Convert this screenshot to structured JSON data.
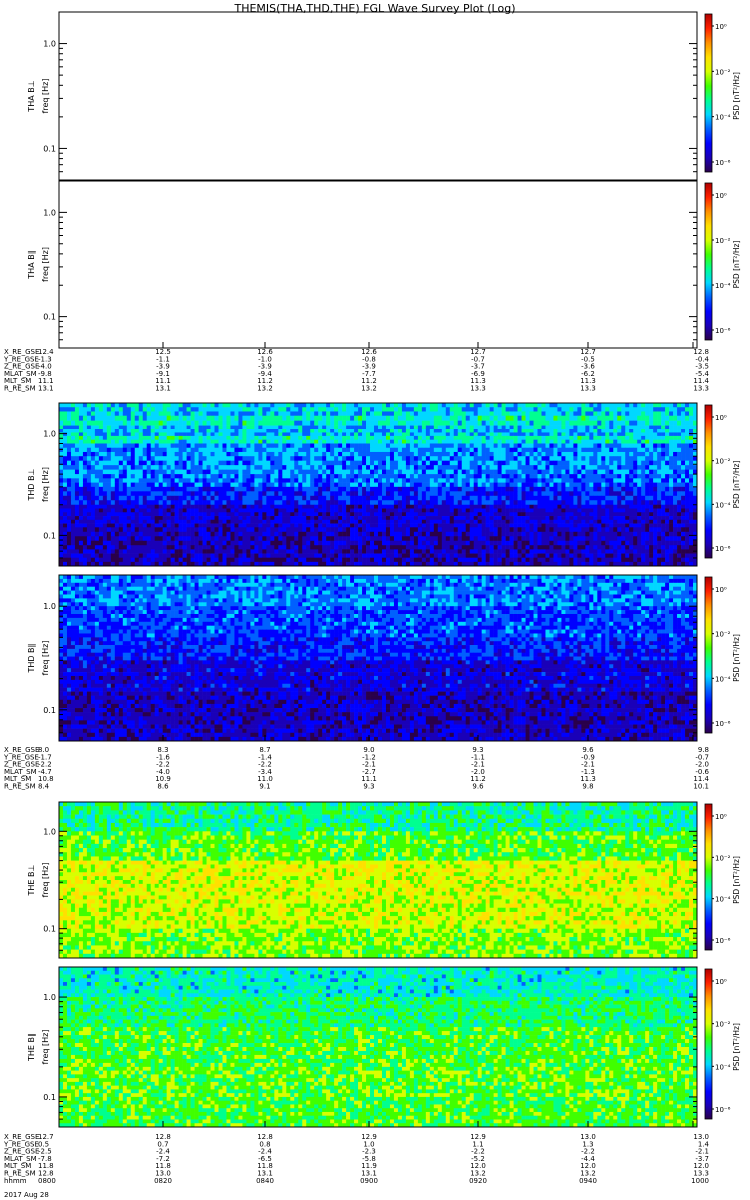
{
  "title": "THEMIS(THA,THD,THE) FGL Wave Survey Plot (Log)",
  "colors": {
    "missing": "#ffffff",
    "frame": "#000000"
  },
  "colormap": [
    "#2a004a",
    "#1a00b8",
    "#0000ff",
    "#0060ff",
    "#00d8ff",
    "#00ff90",
    "#40ff00",
    "#d8ff00",
    "#ffe000",
    "#ff9000",
    "#ff2000",
    "#b00000"
  ],
  "colorbar": {
    "label": "PSD [nT²/Hz]",
    "ticks": [
      "10⁰",
      "10⁻²",
      "10⁻⁴",
      "10⁻⁶"
    ]
  },
  "chart_data": [
    {
      "type": "heatmap",
      "panel": "THA B⊥",
      "ylabel_probe": "THA B⊥",
      "ylabel": "freq [Hz]",
      "yscale": "log",
      "ylim": [
        0.05,
        2.0
      ],
      "yticks": [
        "1.0",
        "0.1"
      ],
      "ytick_values": [
        1.0,
        0.1
      ],
      "data": "no data (blank)",
      "has_data": false
    },
    {
      "type": "heatmap",
      "panel": "THA B∥",
      "ylabel_probe": "THA B∥",
      "ylabel": "freq [Hz]",
      "yscale": "log",
      "ylim": [
        0.05,
        2.0
      ],
      "yticks": [
        "1.0",
        "0.1"
      ],
      "ytick_values": [
        1.0,
        0.1
      ],
      "data": "no data (blank)",
      "has_data": false
    },
    {
      "type": "heatmap",
      "panel": "THD B⊥",
      "ylabel_probe": "THD B⊥",
      "ylabel": "freq [Hz]",
      "yscale": "log",
      "ylim": [
        0.05,
        2.0
      ],
      "yticks": [
        "1.0",
        "0.1"
      ],
      "ytick_values": [
        1.0,
        0.1
      ],
      "has_data": true,
      "bands": [
        {
          "f": [
            1.5,
            2.0
          ],
          "level": 4.0
        },
        {
          "f": [
            1.2,
            1.5
          ],
          "level": 4.5
        },
        {
          "f": [
            0.95,
            1.2
          ],
          "level": 3.8
        },
        {
          "f": [
            0.8,
            0.95
          ],
          "level": 4.5
        },
        {
          "f": [
            0.6,
            0.8
          ],
          "level": 3.4
        },
        {
          "f": [
            0.4,
            0.6
          ],
          "level": 3.2
        },
        {
          "f": [
            0.3,
            0.4
          ],
          "level": 3.0
        },
        {
          "f": [
            0.2,
            0.3
          ],
          "level": 2.2
        },
        {
          "f": [
            0.12,
            0.2
          ],
          "level": 1.4
        },
        {
          "f": [
            0.08,
            0.12
          ],
          "level": 1.1
        },
        {
          "f": [
            0.05,
            0.08
          ],
          "level": 1.0
        }
      ]
    },
    {
      "type": "heatmap",
      "panel": "THD B∥",
      "ylabel_probe": "THD B∥",
      "ylabel": "freq [Hz]",
      "yscale": "log",
      "ylim": [
        0.05,
        2.0
      ],
      "yticks": [
        "1.0",
        "0.1"
      ],
      "ytick_values": [
        1.0,
        0.1
      ],
      "has_data": true,
      "bands": [
        {
          "f": [
            1.0,
            2.0
          ],
          "level": 3.2
        },
        {
          "f": [
            0.5,
            1.0
          ],
          "level": 2.6
        },
        {
          "f": [
            0.3,
            0.5
          ],
          "level": 2.2
        },
        {
          "f": [
            0.15,
            0.3
          ],
          "level": 1.5
        },
        {
          "f": [
            0.05,
            0.15
          ],
          "level": 1.1
        }
      ]
    },
    {
      "type": "heatmap",
      "panel": "THE B⊥",
      "ylabel_probe": "THE B⊥",
      "ylabel": "freq [Hz]",
      "yscale": "log",
      "ylim": [
        0.05,
        2.0
      ],
      "yticks": [
        "1.0",
        "0.1"
      ],
      "ytick_values": [
        1.0,
        0.1
      ],
      "has_data": true,
      "bands": [
        {
          "f": [
            1.0,
            2.0
          ],
          "level": 5.0
        },
        {
          "f": [
            0.5,
            1.0
          ],
          "level": 6.0
        },
        {
          "f": [
            0.2,
            0.5
          ],
          "level": 7.2
        },
        {
          "f": [
            0.1,
            0.2
          ],
          "level": 7.0
        },
        {
          "f": [
            0.05,
            0.1
          ],
          "level": 6.3
        }
      ]
    },
    {
      "type": "heatmap",
      "panel": "THE B∥",
      "ylabel_probe": "THE B∥",
      "ylabel": "freq [Hz]",
      "yscale": "log",
      "ylim": [
        0.05,
        2.0
      ],
      "yticks": [
        "1.0",
        "0.1"
      ],
      "ytick_values": [
        1.0,
        0.1
      ],
      "has_data": true,
      "bands": [
        {
          "f": [
            1.0,
            2.0
          ],
          "level": 4.5
        },
        {
          "f": [
            0.5,
            1.0
          ],
          "level": 5.3
        },
        {
          "f": [
            0.2,
            0.5
          ],
          "level": 5.8
        },
        {
          "f": [
            0.1,
            0.2
          ],
          "level": 6.0
        },
        {
          "f": [
            0.05,
            0.1
          ],
          "level": 5.8
        }
      ]
    }
  ],
  "ephemeris": [
    {
      "probe": "THA",
      "rows": [
        {
          "label": "X_RE_GSE",
          "values": [
            "12.4",
            "12.5",
            "12.6",
            "12.6",
            "12.7",
            "12.7",
            "12.8"
          ]
        },
        {
          "label": "Y_RE_GSE",
          "values": [
            "-1.3",
            "-1.1",
            "-1.0",
            "-0.8",
            "-0.7",
            "-0.5",
            "-0.4"
          ]
        },
        {
          "label": "Z_RE_GSE",
          "values": [
            "-4.0",
            "-3.9",
            "-3.9",
            "-3.9",
            "-3.7",
            "-3.6",
            "-3.5"
          ]
        },
        {
          "label": "MLAT_SM",
          "values": [
            "-9.8",
            "-9.1",
            "-9.4",
            "-7.7",
            "-6.9",
            "-6.2",
            "-5.4"
          ]
        },
        {
          "label": "MLT_SM",
          "values": [
            "11.1",
            "11.1",
            "11.2",
            "11.2",
            "11.3",
            "11.3",
            "11.4"
          ]
        },
        {
          "label": "R_RE_SM",
          "values": [
            "13.1",
            "13.1",
            "13.2",
            "13.2",
            "13.3",
            "13.3",
            "13.3"
          ]
        }
      ]
    },
    {
      "probe": "THD",
      "rows": [
        {
          "label": "X_RE_GSE",
          "values": [
            "8.0",
            "8.3",
            "8.7",
            "9.0",
            "9.3",
            "9.6",
            "9.8"
          ]
        },
        {
          "label": "Y_RE_GSE",
          "values": [
            "-1.7",
            "-1.6",
            "-1.4",
            "-1.2",
            "-1.1",
            "-0.9",
            "-0.7"
          ]
        },
        {
          "label": "Z_RE_GSE",
          "values": [
            "-2.2",
            "-2.2",
            "-2.2",
            "-2.1",
            "-2.1",
            "-2.1",
            "-2.0"
          ]
        },
        {
          "label": "MLAT_SM",
          "values": [
            "-4.7",
            "-4.0",
            "-3.4",
            "-2.7",
            "-2.0",
            "-1.3",
            "-0.6"
          ]
        },
        {
          "label": "MLT_SM",
          "values": [
            "10.8",
            "10.9",
            "11.0",
            "11.1",
            "11.2",
            "11.3",
            "11.4"
          ]
        },
        {
          "label": "R_RE_SM",
          "values": [
            "8.4",
            "8.6",
            "9.1",
            "9.3",
            "9.6",
            "9.8",
            "10.1"
          ]
        }
      ]
    },
    {
      "probe": "THE",
      "rows": [
        {
          "label": "X_RE_GSE",
          "values": [
            "12.7",
            "12.8",
            "12.8",
            "12.9",
            "12.9",
            "13.0",
            "13.0"
          ]
        },
        {
          "label": "Y_RE_GSE",
          "values": [
            "0.5",
            "0.7",
            "0.8",
            "1.0",
            "1.1",
            "1.3",
            "1.4"
          ]
        },
        {
          "label": "Z_RE_GSE",
          "values": [
            "-2.5",
            "-2.4",
            "-2.4",
            "-2.3",
            "-2.2",
            "-2.2",
            "-2.1"
          ]
        },
        {
          "label": "MLAT_SM",
          "values": [
            "-7.8",
            "-7.2",
            "-6.5",
            "-5.8",
            "-5.2",
            "-4.4",
            "-3.7"
          ]
        },
        {
          "label": "MLT_SM",
          "values": [
            "11.8",
            "11.8",
            "11.8",
            "11.9",
            "12.0",
            "12.0",
            "12.0"
          ]
        },
        {
          "label": "R_RE_SM",
          "values": [
            "12.8",
            "13.0",
            "13.1",
            "13.1",
            "13.2",
            "13.2",
            "13.3"
          ]
        },
        {
          "label": "hhmm",
          "values": [
            "0800",
            "0820",
            "0840",
            "0900",
            "0920",
            "0940",
            "1000"
          ]
        }
      ]
    }
  ],
  "date_label": "2017 Aug 28"
}
